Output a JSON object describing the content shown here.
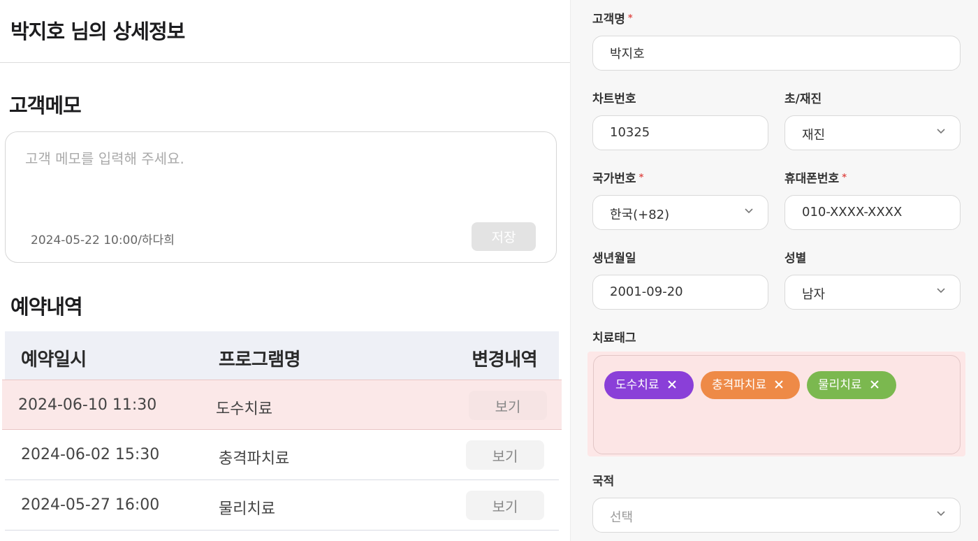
{
  "header": {
    "title": "박지호 님의 상세정보"
  },
  "memo": {
    "title": "고객메모",
    "placeholder": "고객 메모를 입력해 주세요.",
    "meta": "2024-05-22 10:00/하다희",
    "save_label": "저장"
  },
  "reservations": {
    "title": "예약내역",
    "columns": [
      "예약일시",
      "프로그램명",
      "변경내역"
    ],
    "rows": [
      {
        "datetime": "2024-06-10 11:30",
        "program": "도수치료",
        "action": "보기",
        "highlighted": true
      },
      {
        "datetime": "2024-06-02 15:30",
        "program": "충격파치료",
        "action": "보기",
        "highlighted": false
      },
      {
        "datetime": "2024-05-27 16:00",
        "program": "물리치료",
        "action": "보기",
        "highlighted": false
      }
    ]
  },
  "form": {
    "name": {
      "label": "고객명",
      "required": "*",
      "value": "박지호"
    },
    "chart_no": {
      "label": "차트번호",
      "value": "10325"
    },
    "visit_type": {
      "label": "초/재진",
      "value": "재진"
    },
    "country_code": {
      "label": "국가번호",
      "required": "*",
      "value": "한국(+82)"
    },
    "phone": {
      "label": "휴대폰번호",
      "required": "*",
      "value": "010-XXXX-XXXX"
    },
    "birth": {
      "label": "생년월일",
      "value": "2001-09-20"
    },
    "gender": {
      "label": "성별",
      "value": "남자"
    },
    "tags": {
      "label": "치료태그",
      "items": [
        {
          "name": "도수치료",
          "color": "#8a3fd8"
        },
        {
          "name": "충격파치료",
          "color": "#ee8a47"
        },
        {
          "name": "물리치료",
          "color": "#7bb84f"
        }
      ]
    },
    "nationality": {
      "label": "국적",
      "placeholder": "선택"
    }
  },
  "colors": {
    "highlight_row": "#fbe8e8",
    "required_mark": "#e0524f",
    "panel_bg": "#f7f7f7"
  }
}
